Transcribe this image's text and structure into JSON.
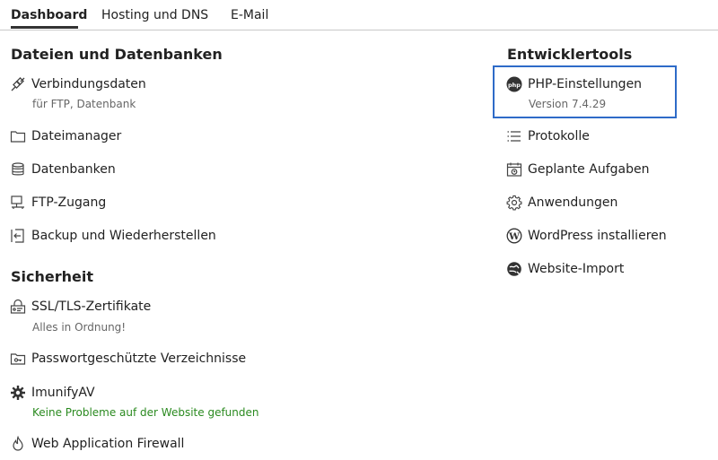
{
  "tabs": [
    {
      "label": "Dashboard",
      "active": true
    },
    {
      "label": "Hosting und DNS",
      "active": false
    },
    {
      "label": "E-Mail",
      "active": false
    }
  ],
  "files_section": {
    "title": "Dateien und Datenbanken",
    "items": [
      {
        "label": "Verbindungsdaten",
        "sub": "für FTP, Datenbank",
        "icon": "plug-icon"
      },
      {
        "label": "Dateimanager",
        "icon": "folder-icon"
      },
      {
        "label": "Datenbanken",
        "icon": "database-icon"
      },
      {
        "label": "FTP-Zugang",
        "icon": "ftp-icon"
      },
      {
        "label": "Backup und Wiederherstellen",
        "icon": "backup-icon"
      }
    ]
  },
  "security_section": {
    "title": "Sicherheit",
    "items": [
      {
        "label": "SSL/TLS-Zertifikate",
        "sub": "Alles in Ordnung!",
        "icon": "certificate-icon"
      },
      {
        "label": "Passwortgeschützte Verzeichnisse",
        "icon": "protected-folder-icon"
      },
      {
        "label": "ImunifyAV",
        "sub": "Keine Probleme auf der Website gefunden",
        "icon": "gear-shield-icon"
      },
      {
        "label": "Web Application Firewall",
        "icon": "fire-icon"
      }
    ]
  },
  "dev_section": {
    "title": "Entwicklertools",
    "items": [
      {
        "label": "PHP-Einstellungen",
        "sub": "Version 7.4.29",
        "icon": "php-icon"
      },
      {
        "label": "Protokolle",
        "icon": "list-icon"
      },
      {
        "label": "Geplante Aufgaben",
        "icon": "calendar-icon"
      },
      {
        "label": "Anwendungen",
        "icon": "gear-icon"
      },
      {
        "label": "WordPress installieren",
        "icon": "wordpress-icon"
      },
      {
        "label": "Website-Import",
        "icon": "globe-import-icon"
      }
    ]
  },
  "colors": {
    "accent": "#2e6bc8",
    "success": "#2a8a1f"
  }
}
